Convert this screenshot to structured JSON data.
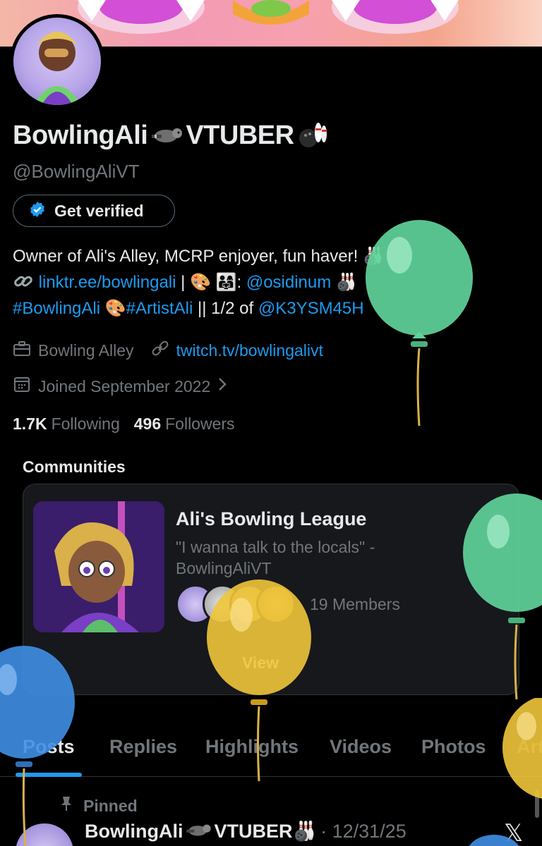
{
  "profile": {
    "display_name": "BowlingAli",
    "display_name_suffix": "VTUBER",
    "handle": "@BowlingAliVT",
    "get_verified_label": "Get verified",
    "bio_line1": "Owner of Ali's Alley, MCRP enjoyer, fun haver!",
    "bio_link": "linktr.ee/bowlingali",
    "bio_sep": "|",
    "bio_mention1": "@osidinum",
    "bio_hashtag1": "#BowlingAli",
    "bio_hashtag2": "#ArtistAli",
    "bio_between": "|| 1/2 of",
    "bio_mention2": "@K3YSM45H",
    "category": "Bowling Alley",
    "website": "twitch.tv/bowlingalivt",
    "joined": "Joined September 2022"
  },
  "stats": {
    "following_count": "1.7K",
    "following_label": "Following",
    "followers_count": "496",
    "followers_label": "Followers"
  },
  "communities": {
    "title": "Communities",
    "card": {
      "name": "Ali's Bowling League",
      "description": "\"I wanna talk to the locals\" - BowlingAliVT",
      "members": "19 Members",
      "view_label": "View"
    }
  },
  "tabs": [
    "Posts",
    "Replies",
    "Highlights",
    "Videos",
    "Photos",
    "Art"
  ],
  "pinned_post": {
    "pinned_label": "Pinned",
    "author": "BowlingAli",
    "author_suffix": "VTUBER",
    "date": "· 12/31/25"
  },
  "colors": {
    "link": "#1d9bf0",
    "muted": "#71767b",
    "balloon_green": "#5fd39a",
    "balloon_yellow": "#f0c53a",
    "balloon_blue": "#3f8fe6"
  },
  "icons": [
    "verified-badge-icon",
    "link-icon",
    "palette-icon",
    "briefcase-icon",
    "calendar-icon",
    "chevron-right-icon",
    "pin-icon",
    "x-logo-icon",
    "raccoon-emoji",
    "bowling-emoji"
  ]
}
